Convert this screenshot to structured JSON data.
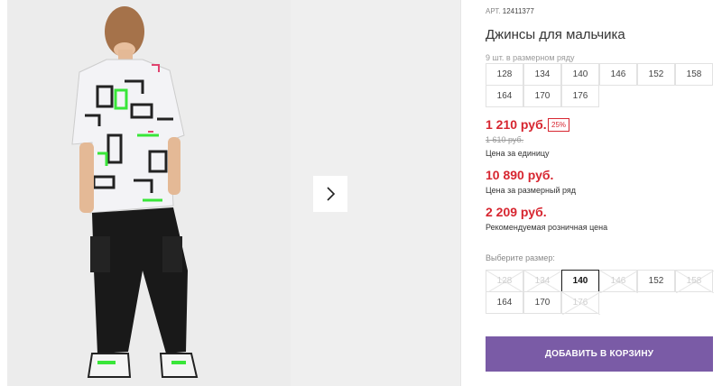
{
  "product": {
    "article_label": "АРТ.",
    "article_number": "12411377",
    "title": "Джинсы для мальчика"
  },
  "size_range": {
    "count_text": "9 шт. в размерном ряду",
    "sizes": [
      "128",
      "134",
      "140",
      "146",
      "152",
      "158",
      "164",
      "170",
      "176"
    ]
  },
  "prices": {
    "unit_price": "1 210 руб.",
    "discount_badge": "25%",
    "old_price": "1 610 руб.",
    "unit_note": "Цена за единицу",
    "range_price": "10 890 руб.",
    "range_note": "Цена за размерный ряд",
    "retail_price": "2 209 руб.",
    "retail_note": "Рекомендуемая розничная цена"
  },
  "size_select": {
    "label": "Выберите размер:",
    "options": [
      {
        "value": "128",
        "available": false
      },
      {
        "value": "134",
        "available": false
      },
      {
        "value": "140",
        "available": true,
        "selected": true
      },
      {
        "value": "146",
        "available": false
      },
      {
        "value": "152",
        "available": true
      },
      {
        "value": "158",
        "available": false
      },
      {
        "value": "164",
        "available": true
      },
      {
        "value": "170",
        "available": true
      },
      {
        "value": "176",
        "available": false
      }
    ]
  },
  "cart": {
    "add_label": "ДОБАВИТЬ В КОРЗИНУ"
  },
  "gallery": {
    "next_icon": "chevron-right-icon"
  },
  "colors": {
    "price_red": "#d72630",
    "button_purple": "#7a5ba6",
    "shirt_green": "#39e639"
  }
}
